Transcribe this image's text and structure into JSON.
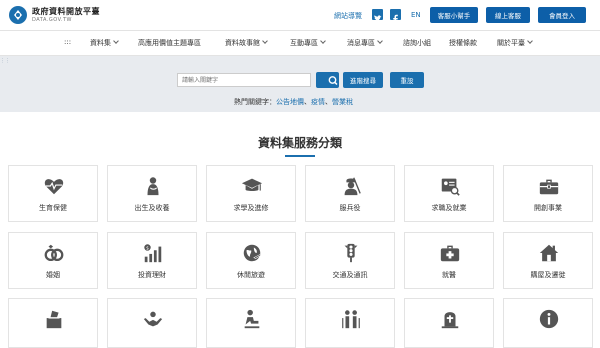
{
  "header": {
    "logo_title": "政府資料開放平臺",
    "logo_subtitle": "DATA.GOV.TW",
    "sitemap": "網站導覽",
    "lang": "EN",
    "buttons": [
      "客服小幫手",
      "線上客服",
      "會員登入"
    ],
    "social_icons": [
      "twitter-icon",
      "facebook-icon"
    ]
  },
  "nav": {
    "items": [
      {
        "label": ":::",
        "dropdown": false
      },
      {
        "label": "資料集",
        "dropdown": true
      },
      {
        "label": "高應用價值主題專區",
        "dropdown": false
      },
      {
        "label": "資料故事館",
        "dropdown": true
      },
      {
        "label": "互動專區",
        "dropdown": true
      },
      {
        "label": "消息專區",
        "dropdown": true
      },
      {
        "label": "諮詢小組",
        "dropdown": false
      },
      {
        "label": "授權條款",
        "dropdown": false
      },
      {
        "label": "關於平臺",
        "dropdown": true
      }
    ]
  },
  "search": {
    "placeholder": "請輸入關鍵字",
    "advanced": "進階搜尋",
    "reset": "重設",
    "hot_label": "熱門關鍵字：",
    "hot_keywords": [
      "公告地價",
      "疫情",
      "營業稅"
    ]
  },
  "section": {
    "title": "資料集服務分類",
    "categories": [
      {
        "label": "生育保健",
        "icon": "heart-pulse-icon"
      },
      {
        "label": "出生及收養",
        "icon": "baby-icon"
      },
      {
        "label": "求學及進修",
        "icon": "graduation-cap-icon"
      },
      {
        "label": "服兵役",
        "icon": "soldier-icon"
      },
      {
        "label": "求職及就業",
        "icon": "resume-search-icon"
      },
      {
        "label": "開創事業",
        "icon": "briefcase-icon"
      },
      {
        "label": "婚姻",
        "icon": "rings-icon"
      },
      {
        "label": "投資理財",
        "icon": "investment-chart-icon"
      },
      {
        "label": "休閒旅遊",
        "icon": "globe-plane-icon"
      },
      {
        "label": "交通及通訊",
        "icon": "traffic-light-icon"
      },
      {
        "label": "就醫",
        "icon": "medical-kit-icon"
      },
      {
        "label": "購屋及遷徙",
        "icon": "house-icon"
      },
      {
        "label": "",
        "icon": "ballot-box-icon"
      },
      {
        "label": "",
        "icon": "hands-care-icon"
      },
      {
        "label": "",
        "icon": "retirement-icon"
      },
      {
        "label": "",
        "icon": "elderly-couple-icon"
      },
      {
        "label": "",
        "icon": "tombstone-icon"
      },
      {
        "label": "",
        "icon": "info-icon"
      }
    ]
  },
  "colors": {
    "primary": "#0d5fa8",
    "accent": "#1b6fae",
    "band": "#e8ebef",
    "icon": "#555555"
  }
}
